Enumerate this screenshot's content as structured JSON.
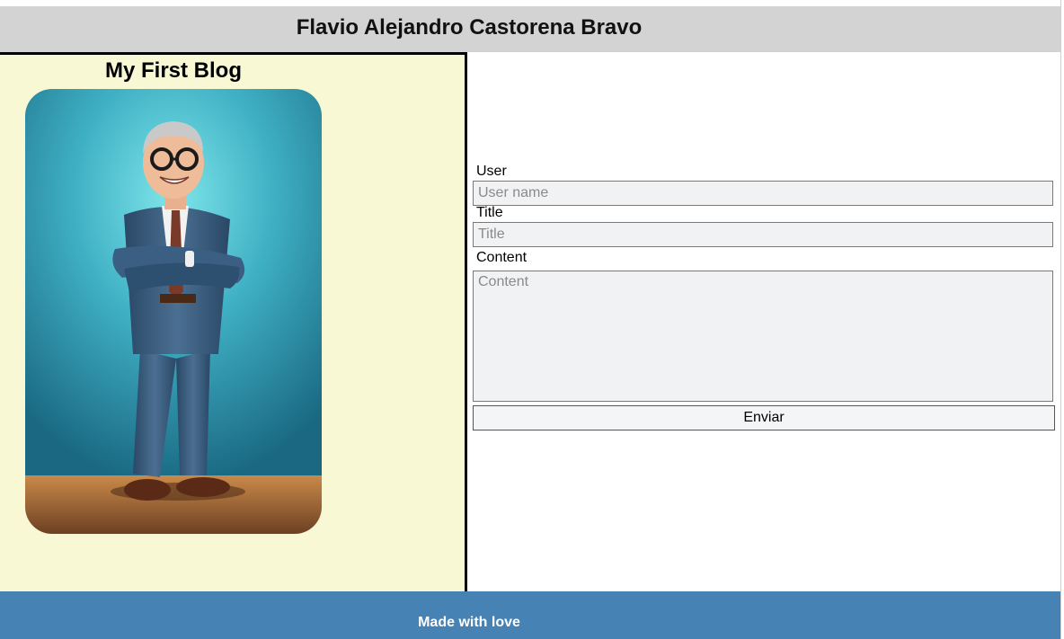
{
  "header": {
    "title": "Flavio Alejandro Castorena Bravo"
  },
  "aside": {
    "heading": "My First Blog",
    "image": {
      "subject": "cartoon-older-man-in-blue-suit"
    }
  },
  "form": {
    "user_label": "User",
    "user_placeholder": "User name",
    "title_label": "Title",
    "title_placeholder": "Title",
    "content_label": "Content",
    "content_placeholder": "Content",
    "submit_label": "Enviar"
  },
  "footer": {
    "text": "Made with love"
  },
  "colors": {
    "header_bg": "#d3d3d3",
    "aside_bg": "#f8f8d5",
    "footer_bg": "#4682b4"
  }
}
